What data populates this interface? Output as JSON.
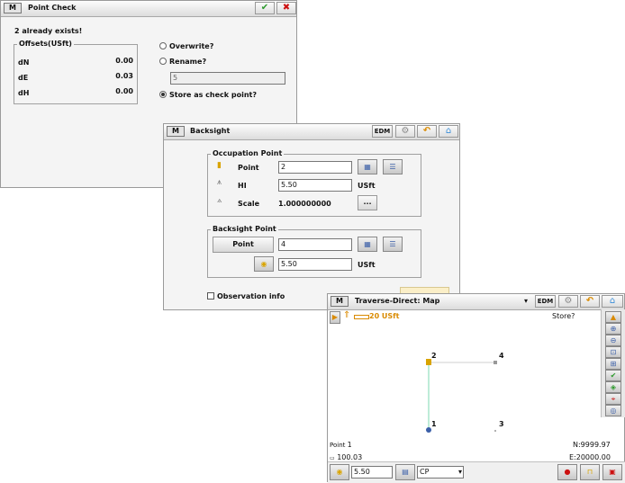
{
  "point_check": {
    "title": "Point Check",
    "message": "2 already exists!",
    "offsets_legend": "Offsets(USft)",
    "offsets": [
      {
        "label": "dN",
        "value": "0.00"
      },
      {
        "label": "dE",
        "value": "0.03"
      },
      {
        "label": "dH",
        "value": "0.00"
      }
    ],
    "options": {
      "overwrite": "Overwrite?",
      "rename": "Rename?",
      "rename_value": "5",
      "store_check": "Store as check point?"
    },
    "selected_option": "store_check"
  },
  "backsight": {
    "title": "Backsight",
    "edm_label": "EDM",
    "occupation_legend": "Occupation Point",
    "point_label": "Point",
    "point_value": "2",
    "hi_label": "HI",
    "hi_value": "5.50",
    "hi_unit": "USft",
    "scale_label": "Scale",
    "scale_value": "1.000000000",
    "scale_btn": "...",
    "backsight_legend": "Backsight Point",
    "bs_point_btn": "Point",
    "bs_point_value": "4",
    "bs_height_value": "5.50",
    "bs_height_unit": "USft",
    "observation_info": "Observation info"
  },
  "map": {
    "title": "Traverse-Direct: Map",
    "edm_label": "EDM",
    "scale_bar": "20 USft",
    "store_label": "Store?",
    "points": [
      {
        "id": "1",
        "label": "1"
      },
      {
        "id": "2",
        "label": "2"
      },
      {
        "id": "3",
        "label": "3"
      },
      {
        "id": "4",
        "label": "4"
      }
    ],
    "point_caption": "Point",
    "point_caption_value": "1",
    "distance_value": "100.03",
    "northing": "N:9999.97",
    "easting": "E:20000.00",
    "height_value": "5.50",
    "code_value": "CP"
  },
  "colors": {
    "accent_green": "#2e9a2e",
    "close_red": "#cc1111",
    "map_line": "#7ed9b0",
    "prism_yellow": "#d9a400"
  }
}
